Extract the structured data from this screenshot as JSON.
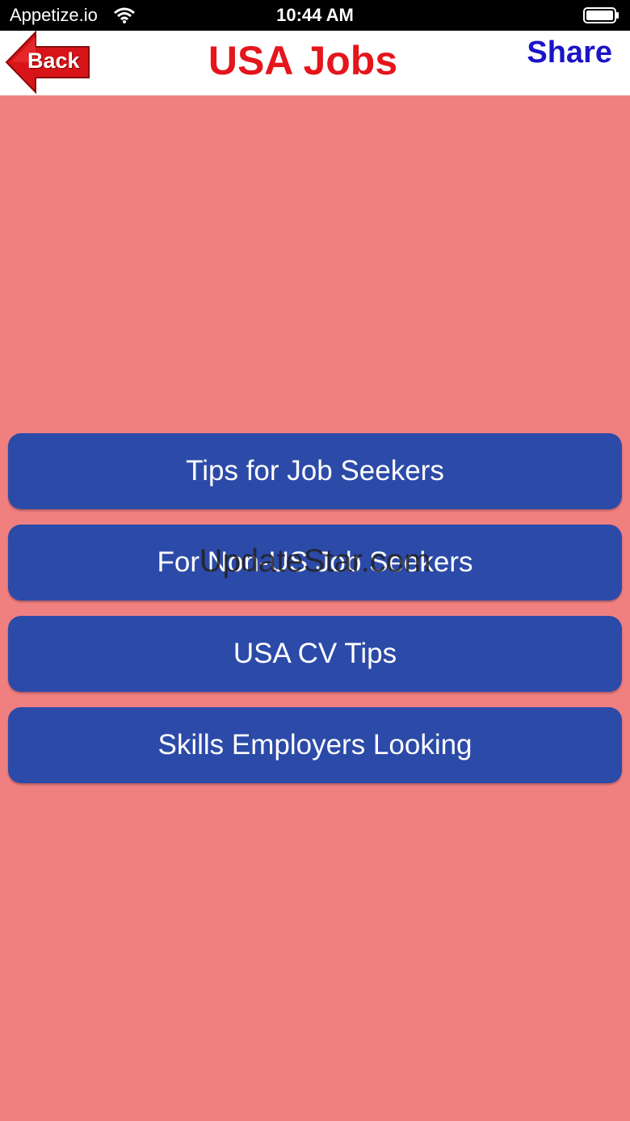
{
  "status_bar": {
    "carrier": "Appetize.io",
    "time": "10:44 AM",
    "icons": [
      "wifi-icon",
      "battery-icon"
    ]
  },
  "nav": {
    "back_label": "Back",
    "title": "USA Jobs",
    "share_label": "Share"
  },
  "menu": {
    "items": [
      {
        "label": "Tips for Job Seekers"
      },
      {
        "label": "For Non-US Job Seekers"
      },
      {
        "label": "USA CV Tips"
      },
      {
        "label": "Skills Employers Looking"
      }
    ]
  },
  "watermark": "UpdateStar.com",
  "colors": {
    "background": "#f08080",
    "button": "#2c4aa8",
    "title": "#e4161c",
    "share": "#1a14c8"
  }
}
